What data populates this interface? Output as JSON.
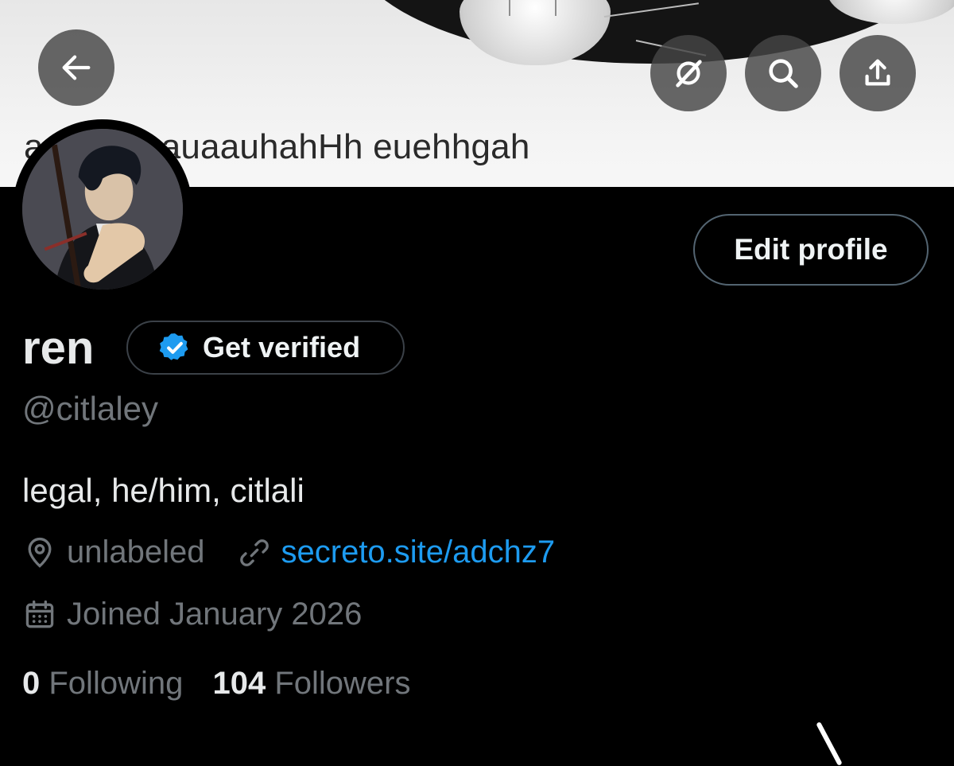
{
  "banner": {
    "caption": "auuuhahauaauhahHh euehhgah"
  },
  "nav": {
    "back_icon": "arrow-left-icon",
    "grok_icon": "grok-icon",
    "search_icon": "search-icon",
    "share_icon": "share-icon"
  },
  "profile": {
    "name": "ren",
    "handle": "@citlaley",
    "bio": "legal, he/him, citlali",
    "location": "unlabeled",
    "website": "secreto.site/adchz7",
    "joined": "Joined January 2026",
    "following_count": "0",
    "following_label": "Following",
    "followers_count": "104",
    "followers_label": "Followers"
  },
  "actions": {
    "edit_profile": "Edit profile",
    "get_verified": "Get verified"
  },
  "colors": {
    "background": "#000000",
    "link": "#1d9bf0",
    "verified_badge": "#1d9bf0",
    "secondary_text": "#71767b",
    "primary_text": "#e7e9ea"
  }
}
